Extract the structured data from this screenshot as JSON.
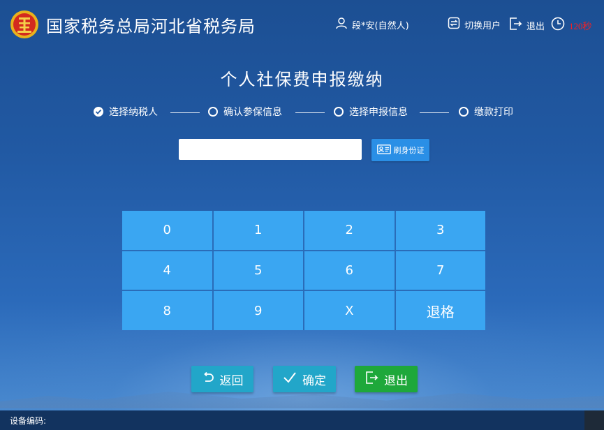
{
  "header": {
    "org_title": "国家税务总局河北省税务局",
    "user_label": "段*安(自然人)",
    "switch_user_label": "切换用户",
    "exit_label": "退出",
    "countdown": "120秒",
    "icons": {
      "emblem": "tax-emblem-icon",
      "user": "user-icon",
      "switch": "switch-user-icon",
      "exit": "exit-icon",
      "clock": "clock-icon"
    }
  },
  "page": {
    "title": "个人社保费申报缴纳"
  },
  "steps": [
    {
      "label": "选择纳税人",
      "done": true
    },
    {
      "label": "确认参保信息",
      "done": false
    },
    {
      "label": "选择申报信息",
      "done": false
    },
    {
      "label": "缴款打印",
      "done": false
    }
  ],
  "id_input": {
    "value": "",
    "placeholder": ""
  },
  "swipe_id_button": {
    "label": "刷身份证",
    "icon": "id-card-icon"
  },
  "keypad": {
    "keys": [
      "0",
      "1",
      "2",
      "3",
      "4",
      "5",
      "6",
      "7",
      "8",
      "9",
      "X",
      "退格"
    ]
  },
  "actions": {
    "back_label": "返回",
    "confirm_label": "确定",
    "exit_label": "退出"
  },
  "footer": {
    "device_label": "设备编码:"
  },
  "colors": {
    "background_top": "#1c4f93",
    "key_blue": "#3aa6f2",
    "teal_button": "#22a6c9",
    "green_button": "#1ea83b",
    "countdown_red": "#ff1e1e"
  }
}
